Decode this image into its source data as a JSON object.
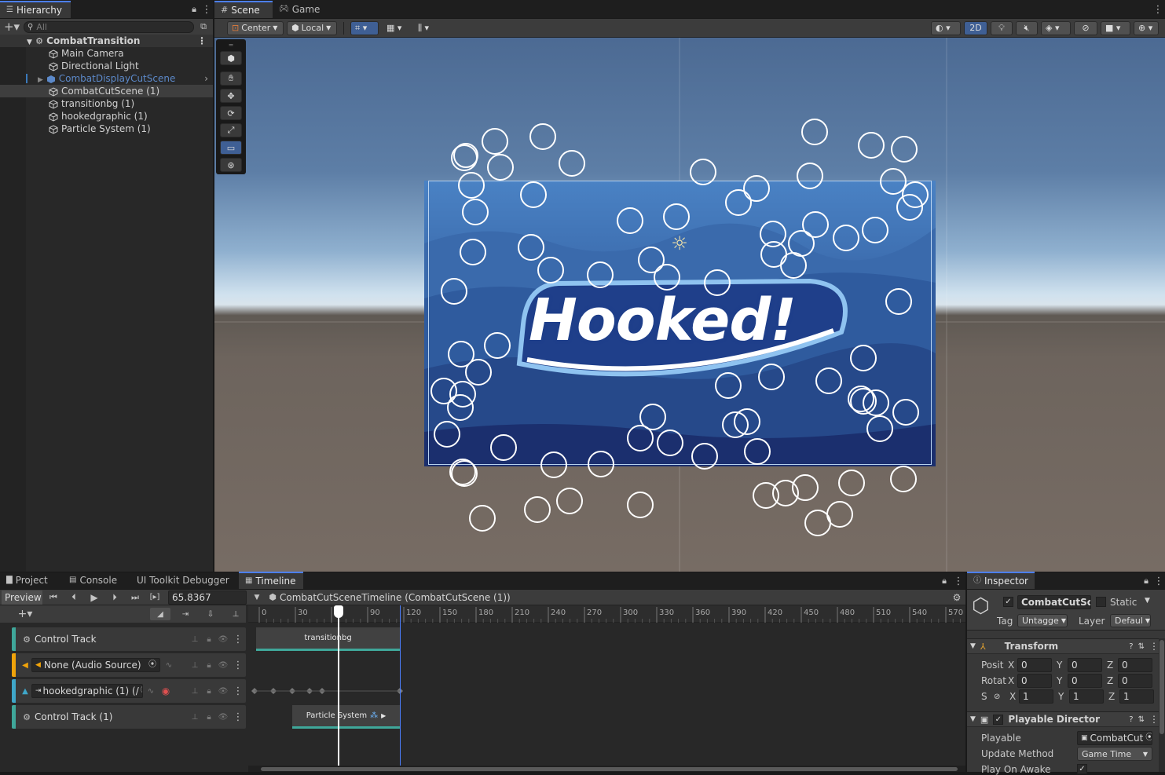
{
  "hierarchy": {
    "tab_label": "Hierarchy",
    "search_placeholder": "All",
    "scene_name": "CombatTransition",
    "items": [
      {
        "label": "Main Camera"
      },
      {
        "label": "Directional Light"
      },
      {
        "label": "CombatDisplayCutScene"
      },
      {
        "label": "CombatCutScene (1)"
      },
      {
        "label": "transitionbg (1)"
      },
      {
        "label": "hookedgraphic (1)"
      },
      {
        "label": "Particle System (1)"
      }
    ]
  },
  "scene_view": {
    "tabs": [
      {
        "label": "Scene"
      },
      {
        "label": "Game"
      }
    ],
    "pivot_label": "Center",
    "space_label": "Local",
    "mode_2d_label": "2D",
    "logo_text": "Hooked!"
  },
  "bottom_tabs": [
    {
      "label": "Project"
    },
    {
      "label": "Console"
    },
    {
      "label": "UI Toolkit Debugger"
    },
    {
      "label": "Timeline"
    }
  ],
  "timeline": {
    "preview_label": "Preview",
    "frame_value": "65.8367",
    "asset_label": "CombatCutSceneTimeline (CombatCutScene (1))",
    "ruler_ticks": [
      "0",
      "30",
      "60",
      "90",
      "120",
      "150",
      "180",
      "210",
      "240",
      "270",
      "300",
      "330",
      "360",
      "390",
      "420",
      "450",
      "480",
      "510",
      "540",
      "570"
    ],
    "playhead_frame": 65.8367,
    "tracks": [
      {
        "label": "Control Track",
        "color": "#3fa79a"
      },
      {
        "label": "None (Audio Source)",
        "color": "#f0a30a"
      },
      {
        "label": "hookedgraphic (1) (/",
        "color": "#3fa7c9"
      },
      {
        "label": "Control Track (1)",
        "color": "#3fa79a"
      }
    ],
    "clips": [
      {
        "label": "transitionbg",
        "track": 0
      },
      {
        "label": "Particle System",
        "track": 3
      }
    ]
  },
  "inspector": {
    "tab_label": "Inspector",
    "object_name": "CombatCutSce",
    "static_label": "Static",
    "tag_label": "Tag",
    "tag_value": "Untagge",
    "layer_label": "Layer",
    "layer_value": "Defaul",
    "transform": {
      "title": "Transform",
      "rows": [
        {
          "label": "Posit",
          "x": "0",
          "y": "0",
          "z": "0"
        },
        {
          "label": "Rotat",
          "x": "0",
          "y": "0",
          "z": "0"
        },
        {
          "label": "S",
          "x": "1",
          "y": "1",
          "z": "1"
        }
      ]
    },
    "playable_director": {
      "title": "Playable Director",
      "playable_label": "Playable",
      "playable_value": "CombatCut",
      "update_method_label": "Update Method",
      "update_method_value": "Game Time",
      "play_on_awake_label": "Play On Awake"
    }
  }
}
